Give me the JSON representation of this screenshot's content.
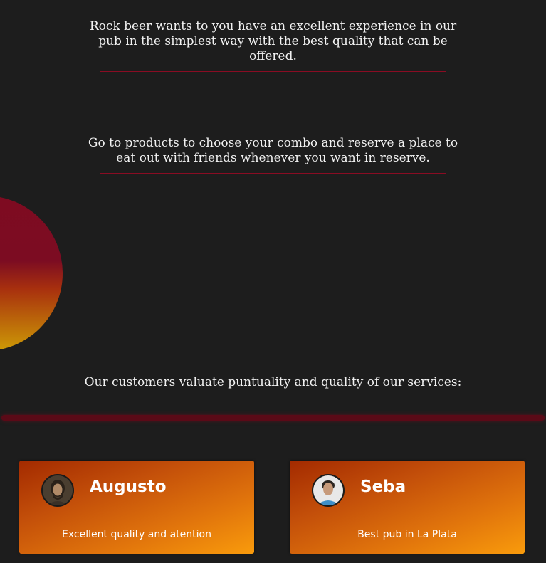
{
  "intro": {
    "paragraph_1": "Rock beer wants to you have an excellent experience in our pub in the simplest way with the best quality that can be offered.",
    "paragraph_2": "Go to products to choose your combo and reserve a place to eat out with friends whenever you want in reserve."
  },
  "testimonials": {
    "heading": "Our customers valuate puntuality and quality of our services:",
    "reviews": [
      {
        "name": "Augusto",
        "text": "Excellent quality and atention"
      },
      {
        "name": "Seba",
        "text": "Best pub in La Plata"
      }
    ]
  },
  "colors": {
    "background": "#1d1d1d",
    "accent_red": "#8a0c23",
    "card_gradient_start": "#a32a00",
    "card_gradient_end": "#f99b0c"
  }
}
